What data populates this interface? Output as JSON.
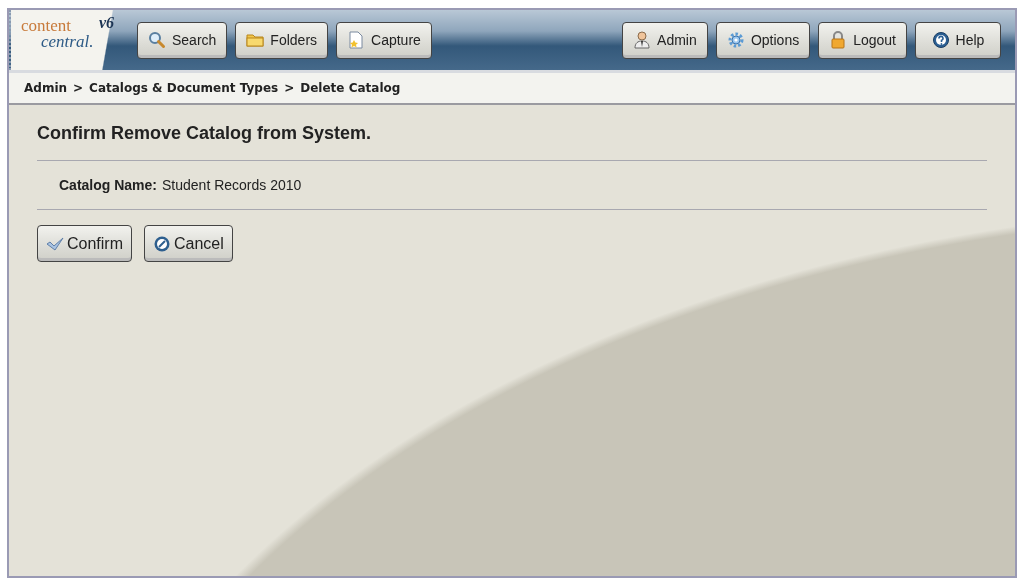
{
  "logo": {
    "line_1": "content",
    "line_2": "central.",
    "version": "v6"
  },
  "nav_left": [
    {
      "label": "Search",
      "kind": "search"
    },
    {
      "label": "Folders",
      "kind": "folder"
    },
    {
      "label": "Capture",
      "kind": "capture"
    }
  ],
  "nav_right": [
    {
      "label": "Admin",
      "kind": "user"
    },
    {
      "label": "Options",
      "kind": "gear"
    },
    {
      "label": "Logout",
      "kind": "lock"
    },
    {
      "label": "Help",
      "kind": "help"
    }
  ],
  "breadcrumb": {
    "separator": ">",
    "items": [
      "Admin",
      "Catalogs & Document Types",
      "Delete Catalog"
    ]
  },
  "heading": "Confirm Remove Catalog from System.",
  "field": {
    "label": "Catalog Name:",
    "value": "Student Records 2010"
  },
  "buttons": [
    {
      "label": "Confirm",
      "kind": "check"
    },
    {
      "label": "Cancel",
      "kind": "cancel"
    }
  ]
}
